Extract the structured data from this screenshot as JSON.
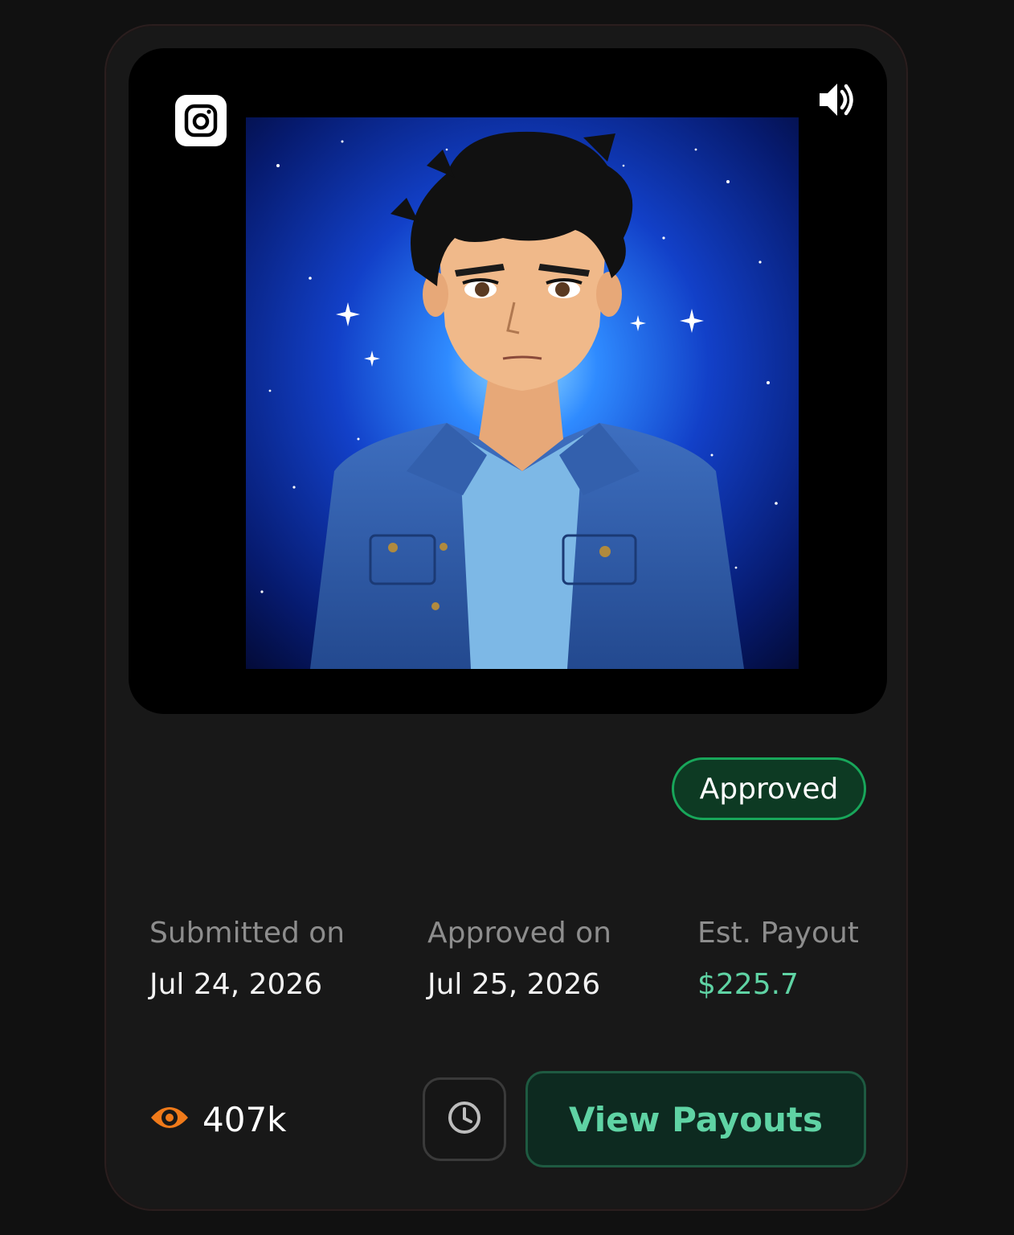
{
  "media": {
    "platform_icon": "instagram-icon",
    "sound_icon": "speaker-volume-icon",
    "thumbnail": "anime-portrait-space-background"
  },
  "status": {
    "label": "Approved",
    "color": "#18a65a"
  },
  "meta": [
    {
      "label": "Submitted on",
      "value": "Jul 24, 2026"
    },
    {
      "label": "Approved on",
      "value": "Jul 25, 2026"
    },
    {
      "label": "Est. Payout",
      "value": "$225.7"
    }
  ],
  "stats": {
    "views_icon": "eye-icon",
    "views": "407k"
  },
  "actions": {
    "history_icon": "clock-icon",
    "payouts_label": "View Payouts"
  },
  "colors": {
    "accent": "#5fd3a4",
    "views_icon": "#f07a1a",
    "card_bg": "#181818"
  }
}
